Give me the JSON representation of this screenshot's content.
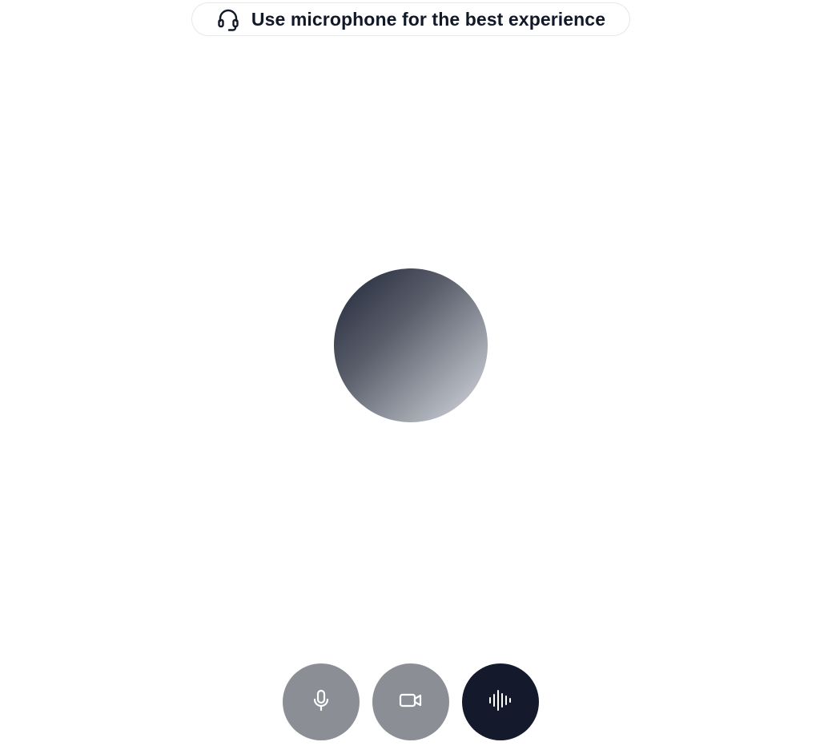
{
  "banner": {
    "text": "Use microphone for the best experience",
    "icon": "headset-icon"
  },
  "controls": [
    {
      "name": "microphone-button",
      "icon": "microphone-icon",
      "color": "#8b8e95"
    },
    {
      "name": "camera-button",
      "icon": "video-camera-icon",
      "color": "#8b8e95"
    },
    {
      "name": "voice-wave-button",
      "icon": "audio-waveform-icon",
      "color": "#141a2b"
    }
  ],
  "colors": {
    "text": "#111827",
    "border": "#e5e7eb",
    "orb_dark": "#1f2537",
    "orb_light": "#d7dae0"
  }
}
